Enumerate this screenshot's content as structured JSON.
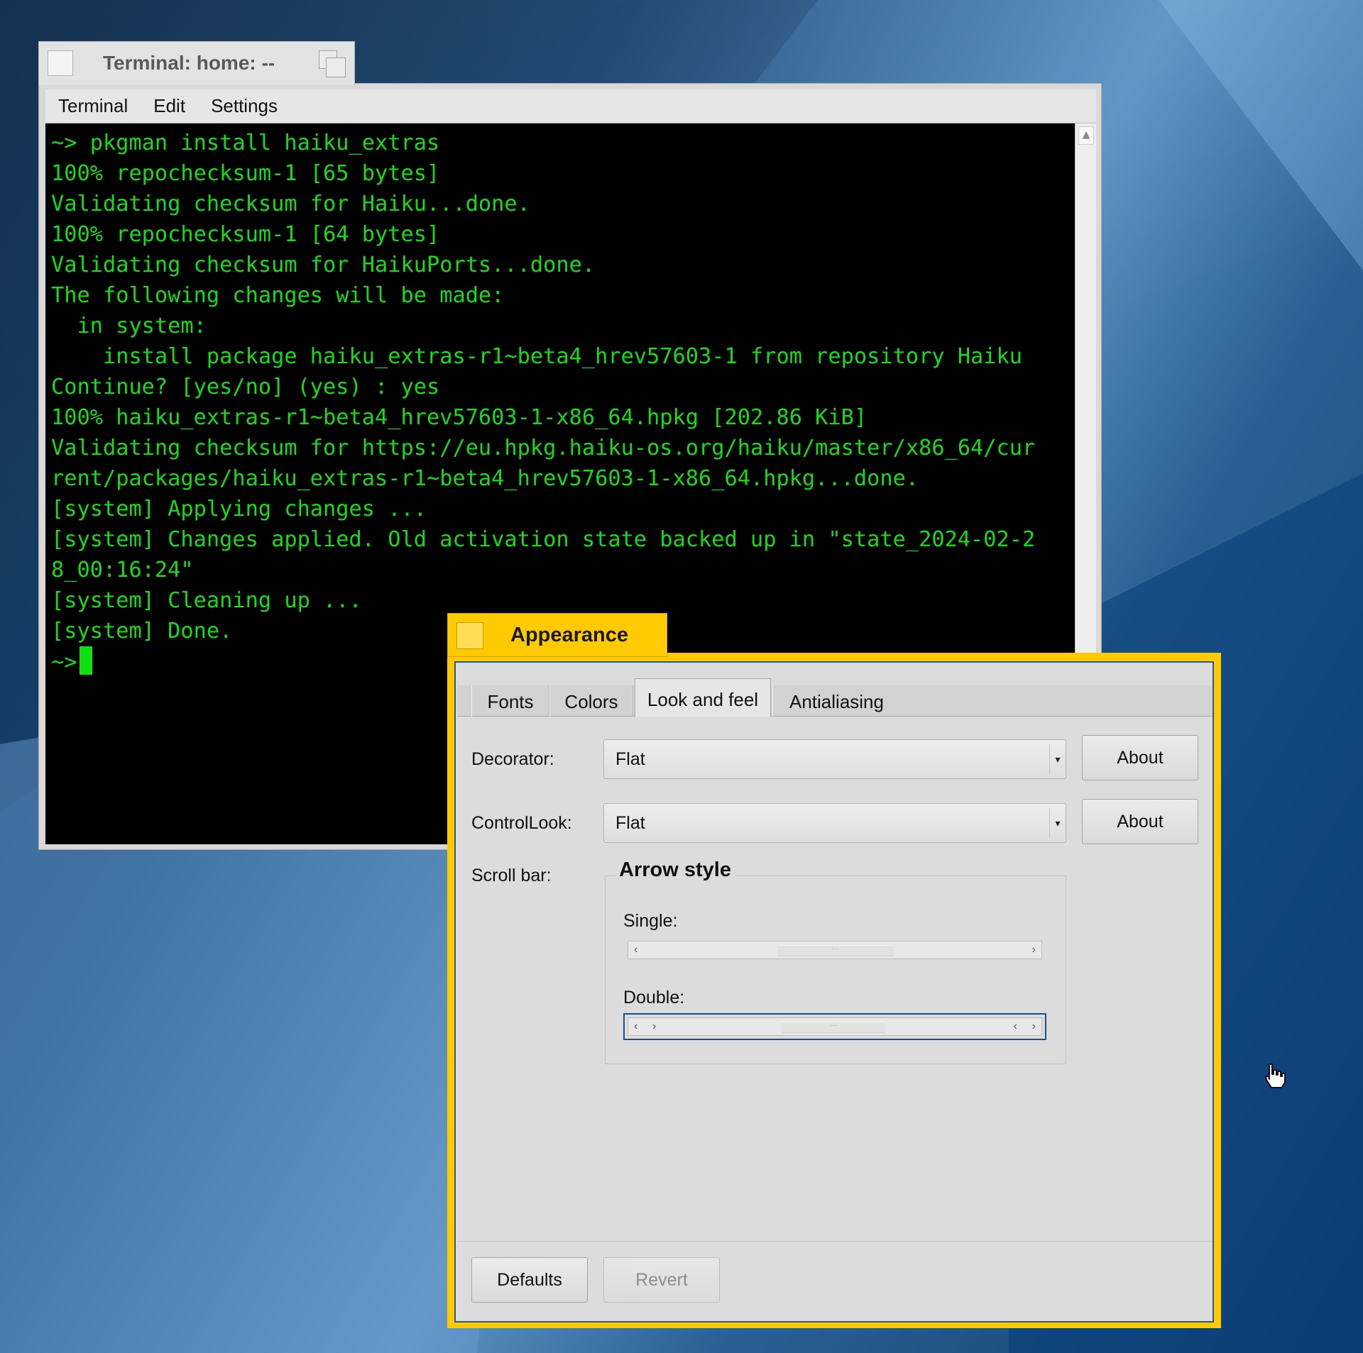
{
  "terminal": {
    "title": "Terminal: home: --",
    "menu": [
      "Terminal",
      "Edit",
      "Settings"
    ],
    "lines": [
      "~> pkgman install haiku_extras",
      "100% repochecksum-1 [65 bytes]",
      "Validating checksum for Haiku...done.",
      "100% repochecksum-1 [64 bytes]",
      "Validating checksum for HaikuPorts...done.",
      "The following changes will be made:",
      "  in system:",
      "    install package haiku_extras-r1~beta4_hrev57603-1 from repository Haiku",
      "Continue? [yes/no] (yes) : yes",
      "100% haiku_extras-r1~beta4_hrev57603-1-x86_64.hpkg [202.86 KiB]",
      "Validating checksum for https://eu.hpkg.haiku-os.org/haiku/master/x86_64/cur",
      "rent/packages/haiku_extras-r1~beta4_hrev57603-1-x86_64.hpkg...done.",
      "[system] Applying changes ...",
      "[system] Changes applied. Old activation state backed up in \"state_2024-02-2",
      "8_00:16:24\"",
      "[system] Cleaning up ...",
      "[system] Done.",
      "~>"
    ],
    "text_color": "#14dd14"
  },
  "appearance": {
    "title": "Appearance",
    "tabs": [
      "Fonts",
      "Colors",
      "Look and feel",
      "Antialiasing"
    ],
    "active_tab": "Look and feel",
    "decorator": {
      "label": "Decorator:",
      "value": "Flat",
      "about": "About"
    },
    "control_look": {
      "label": "ControlLook:",
      "value": "Flat",
      "about": "About"
    },
    "scroll_bar": {
      "label": "Scroll bar:",
      "group_title": "Arrow style",
      "single_label": "Single:",
      "double_label": "Double:",
      "selected": "Double"
    },
    "buttons": {
      "defaults": "Defaults",
      "revert": "Revert"
    },
    "accent_color": "#ffcb00"
  }
}
